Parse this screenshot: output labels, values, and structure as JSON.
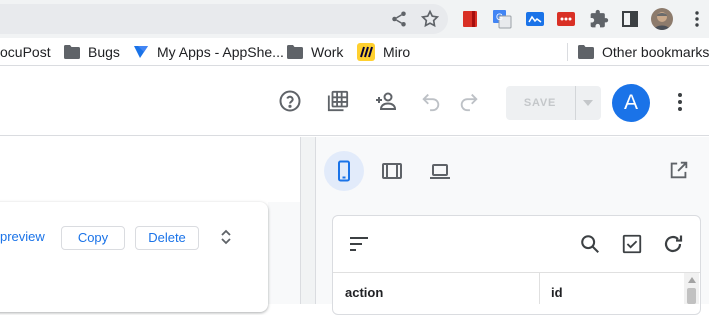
{
  "bookmarks": {
    "items": [
      {
        "label": "ocuPost"
      },
      {
        "label": "Bugs"
      },
      {
        "label": "My Apps - AppShe..."
      },
      {
        "label": "Work"
      },
      {
        "label": "Miro"
      }
    ],
    "other": "Other bookmarks"
  },
  "header": {
    "save_label": "SAVE",
    "avatar_initial": "A"
  },
  "editor": {
    "preview_label": "preview",
    "copy_label": "Copy",
    "delete_label": "Delete"
  },
  "preview": {
    "columns": [
      "action",
      "id"
    ]
  },
  "colors": {
    "accent": "#1a73e8",
    "selected_device_bg": "#e2ebfa"
  }
}
